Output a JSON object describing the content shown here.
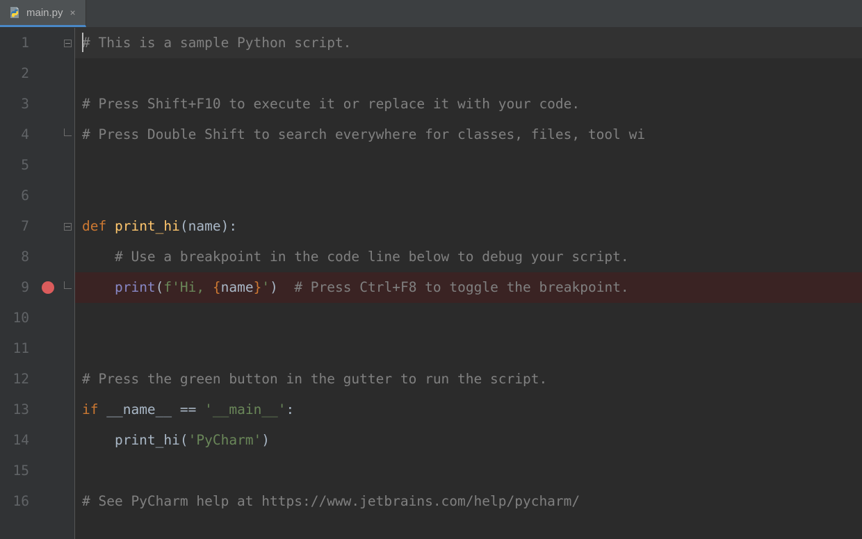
{
  "tab": {
    "label": "main.py",
    "close": "×"
  },
  "lines": [
    "1",
    "2",
    "3",
    "4",
    "5",
    "6",
    "7",
    "8",
    "9",
    "10",
    "11",
    "12",
    "13",
    "14",
    "15",
    "16"
  ],
  "breakpoint_line": 9,
  "code": {
    "l1": "# This is a sample Python script.",
    "l3": "# Press Shift+F10 to execute it or replace it with your code.",
    "l4": "# Press Double Shift to search everywhere for classes, files, tool wi",
    "l7_def": "def ",
    "l7_fn": "print_hi",
    "l7_rest": "(name):",
    "l8": "    # Use a breakpoint in the code line below to debug your script.",
    "l9_indent": "    ",
    "l9_print": "print",
    "l9_op": "(",
    "l9_f": "f'Hi, ",
    "l9_lb": "{",
    "l9_name": "name",
    "l9_rb": "}",
    "l9_strend": "'",
    "l9_cp": ")",
    "l9_sp": "  ",
    "l9_cmt": "# Press Ctrl+F8 to toggle the breakpoint.",
    "l12": "# Press the green button in the gutter to run the script.",
    "l13_if": "if ",
    "l13_name": "__name__ == ",
    "l13_str": "'__main__'",
    "l13_colon": ":",
    "l14_indent": "    print_hi(",
    "l14_str": "'PyCharm'",
    "l14_cp": ")",
    "l16": "# See PyCharm help at https://www.jetbrains.com/help/pycharm/"
  }
}
